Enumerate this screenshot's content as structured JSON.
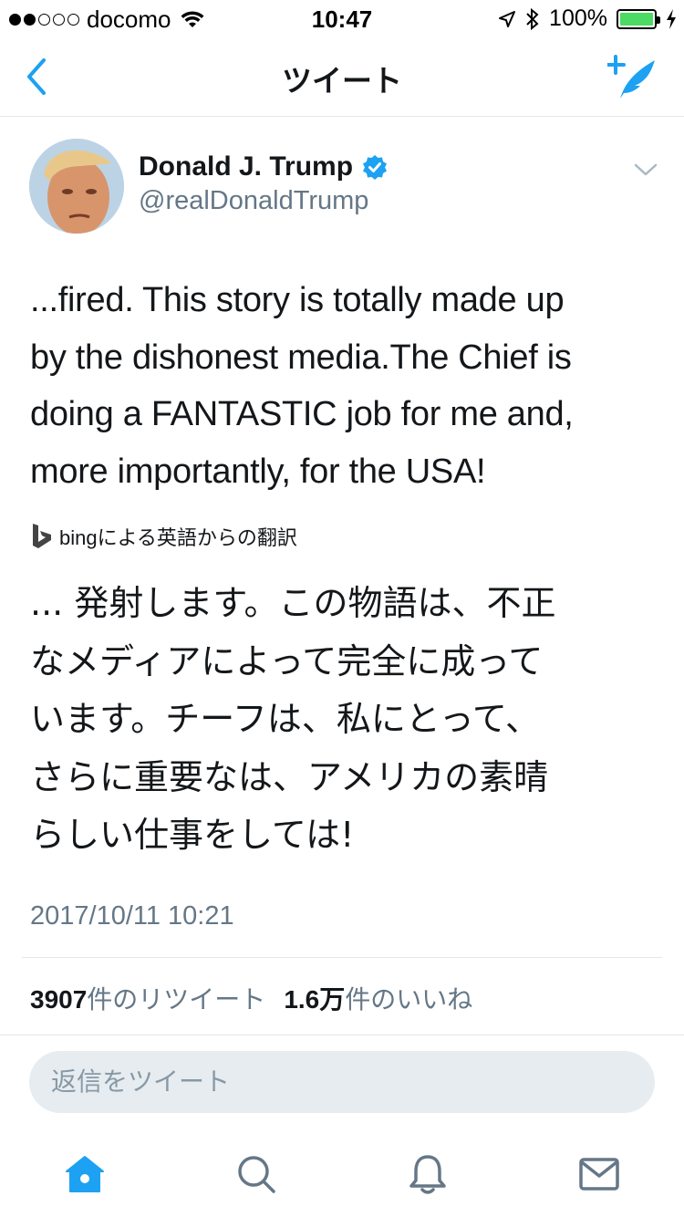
{
  "status_bar": {
    "carrier": "docomo",
    "time": "10:47",
    "battery": "100%",
    "battery_level": 1.0
  },
  "nav": {
    "title": "ツイート",
    "back_icon": "chevron-left-icon",
    "compose_icon": "compose-tweet-icon"
  },
  "tweet": {
    "author_name": "Donald J. Trump",
    "handle": "@realDonaldTrump",
    "verified": true,
    "text_lines": [
      "...fired. This story is totally made up",
      "by the dishonest media.The Chief is",
      "doing a FANTASTIC job for me and,",
      "more importantly, for the USA!"
    ],
    "translation_label": "bingによる英語からの翻訳",
    "translated_lines": [
      "... 発射します。この物語は、不正",
      "なメディアによって完全に成って",
      "います。チーフは、私にとって、",
      "さらに重要なは、アメリカの素晴",
      "らしい仕事をしては!"
    ],
    "timestamp": "2017/10/11 10:21",
    "retweet_count": "3907",
    "retweet_label": "件のリツイート",
    "like_count": "1.6万",
    "like_label": "件のいいね"
  },
  "reply": {
    "placeholder": "返信をツイート"
  },
  "colors": {
    "accent": "#1da1f2",
    "secondary_text": "#657786",
    "reply_bg": "#e6ecf0",
    "battery_green": "#4cd964"
  },
  "tabs": [
    "home-icon",
    "search-icon",
    "notifications-icon",
    "messages-icon"
  ]
}
